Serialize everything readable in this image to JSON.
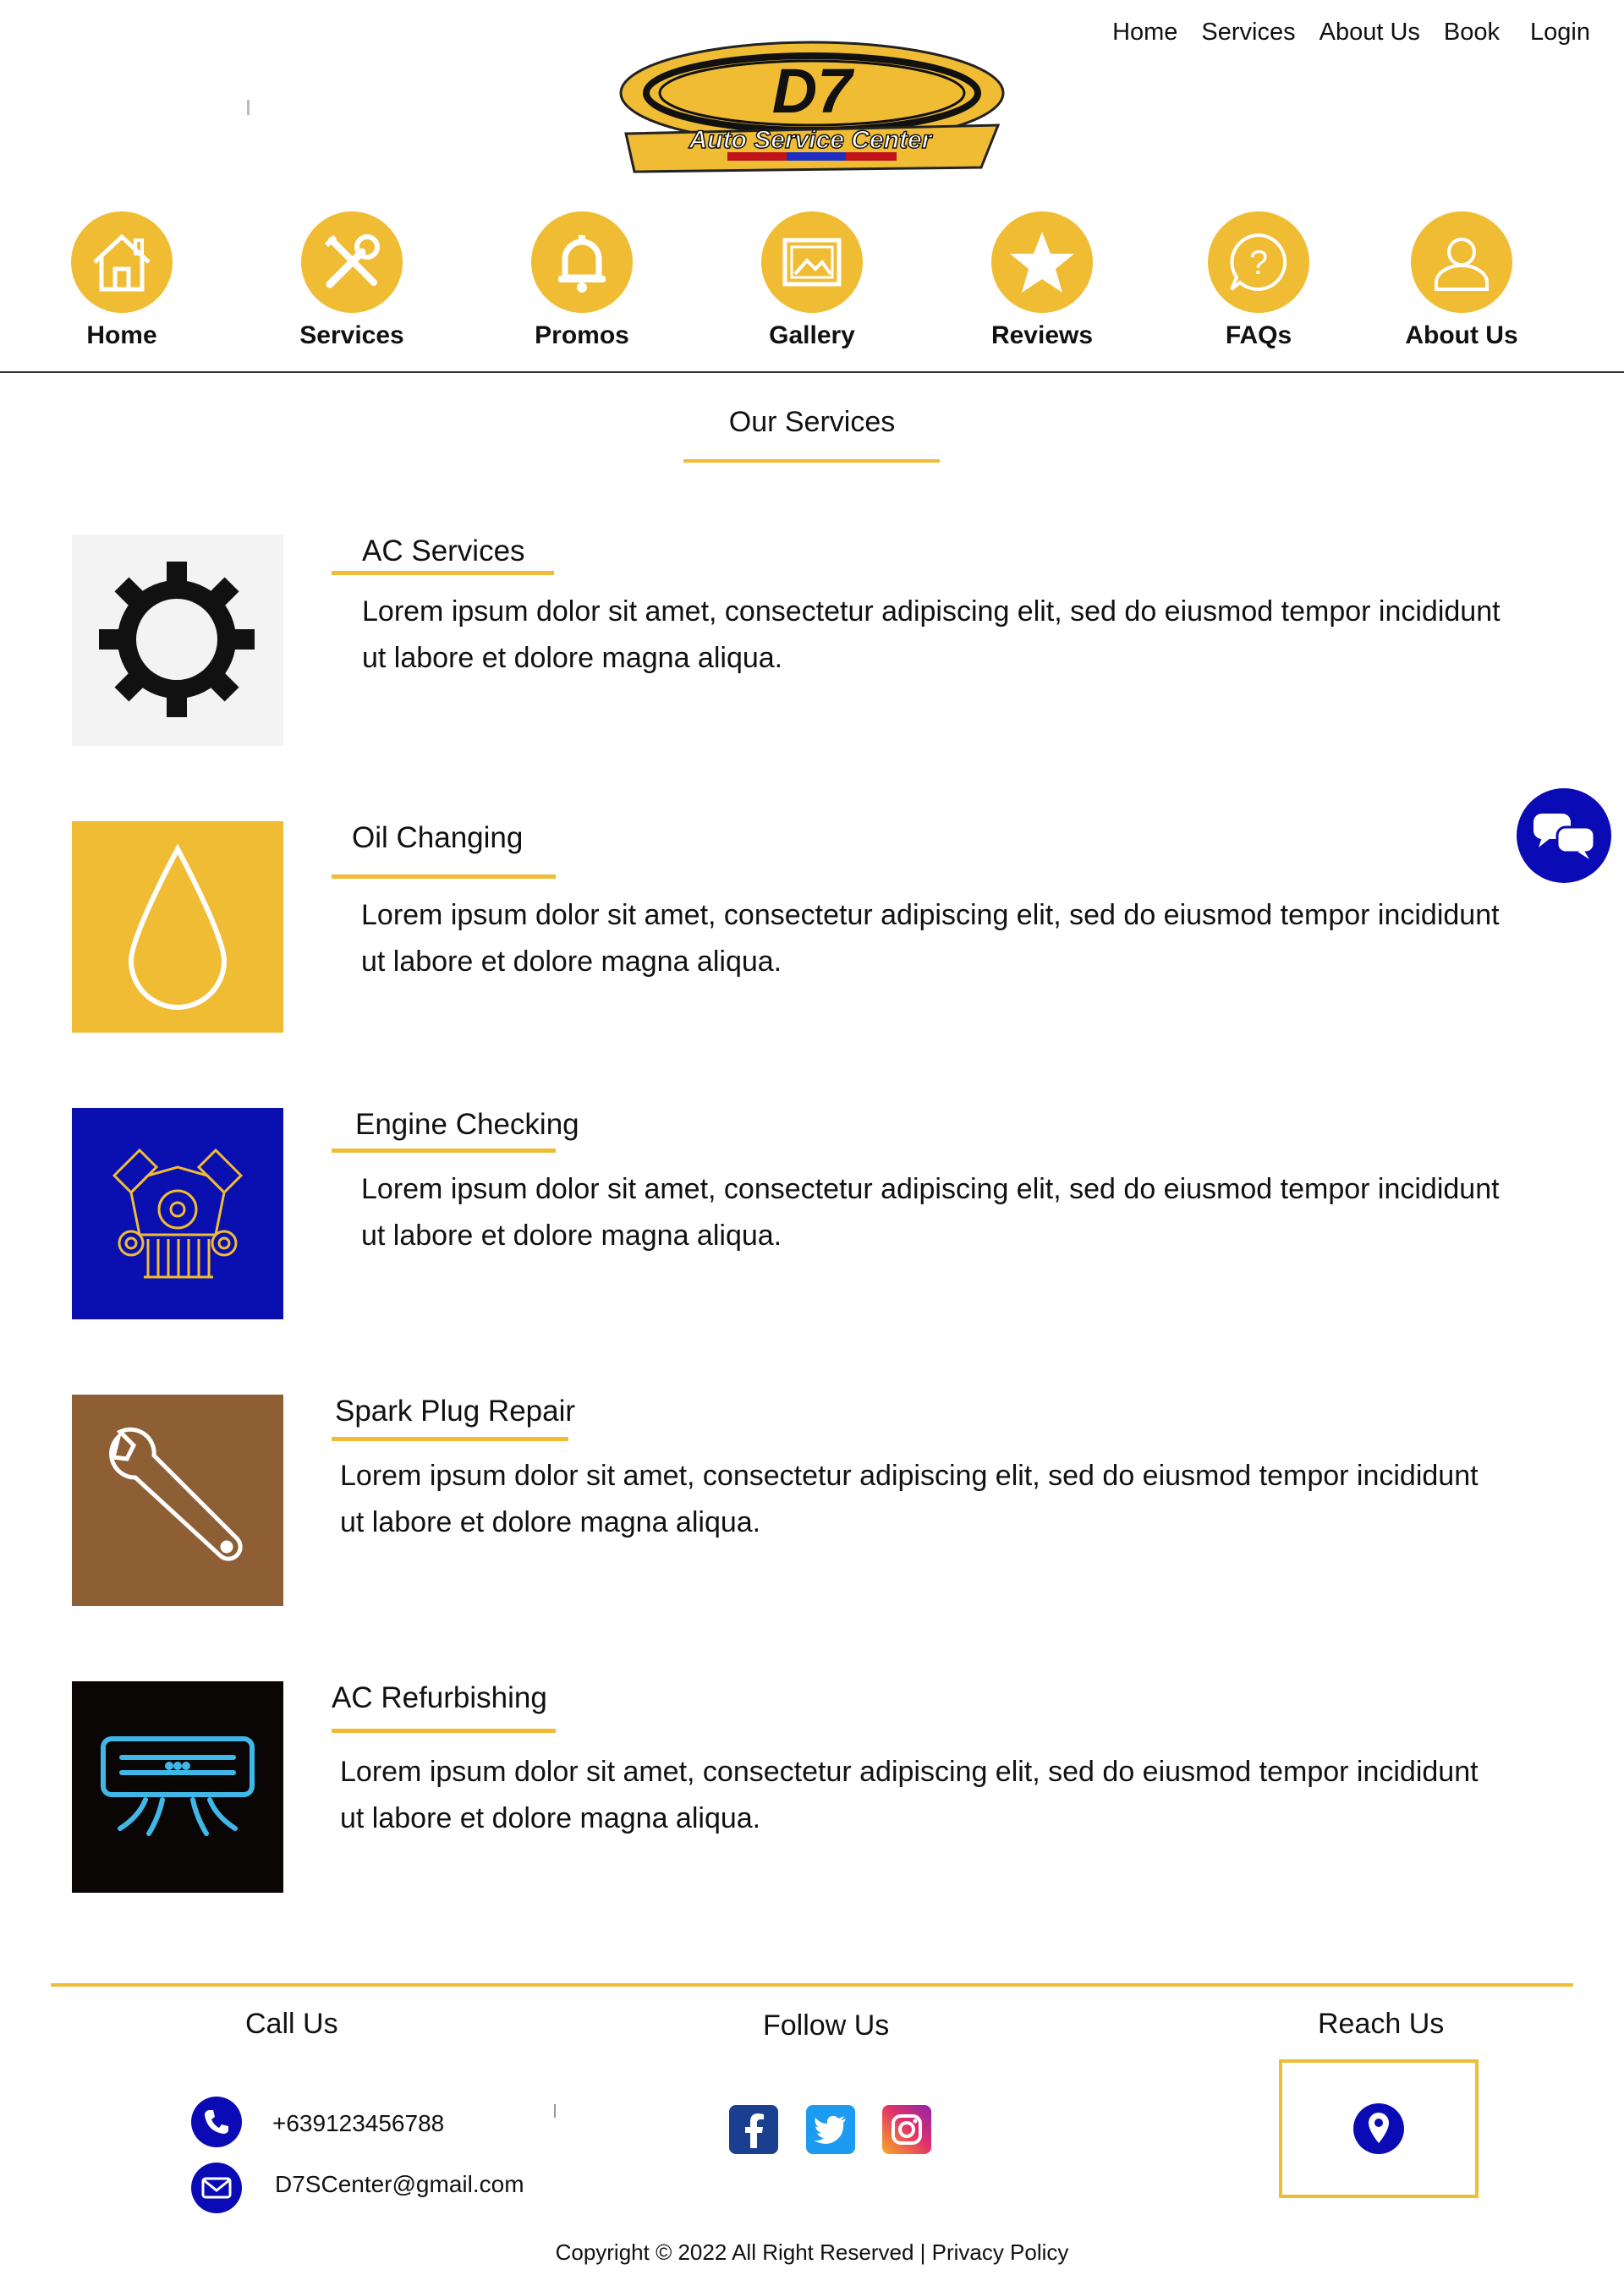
{
  "topnav": [
    "Home",
    "Services",
    "About Us",
    "Book",
    "Login"
  ],
  "logo": {
    "big": "D7",
    "sub": "Auto Service Center"
  },
  "iconnav": [
    {
      "label": "Home",
      "icon": "home-icon"
    },
    {
      "label": "Services",
      "icon": "tools-icon"
    },
    {
      "label": "Promos",
      "icon": "bell-icon"
    },
    {
      "label": "Gallery",
      "icon": "image-icon"
    },
    {
      "label": "Reviews",
      "icon": "star-icon"
    },
    {
      "label": "FAQs",
      "icon": "question-icon"
    },
    {
      "label": "About Us",
      "icon": "user-icon"
    }
  ],
  "section_title": "Our Services",
  "services": [
    {
      "title": "AC Services",
      "desc_line1": "Lorem ipsum dolor sit amet, consectetur adipiscing elit, sed do eiusmod tempor incididunt",
      "desc_line2": "ut labore et dolore magna aliqua.",
      "icon": "gear-icon",
      "bg": "#F3F3F3"
    },
    {
      "title": "Oil Changing",
      "desc_line1": "Lorem ipsum dolor sit amet, consectetur adipiscing elit, sed do eiusmod tempor incididunt",
      "desc_line2": "ut labore et dolore magna aliqua.",
      "icon": "oil-drop-icon",
      "bg": "#F0BC34"
    },
    {
      "title": "Engine Checking",
      "desc_line1": "Lorem ipsum dolor sit amet, consectetur adipiscing elit, sed do eiusmod tempor incididunt",
      "desc_line2": "ut labore et dolore magna aliqua.",
      "icon": "engine-icon",
      "bg": "#0A0FB0"
    },
    {
      "title": "Spark Plug Repair",
      "desc_line1": "Lorem ipsum dolor sit amet, consectetur adipiscing elit, sed do eiusmod tempor incididunt",
      "desc_line2": "ut labore et dolore magna aliqua.",
      "icon": "wrench-icon",
      "bg": "#8E5F34"
    },
    {
      "title": "AC Refurbishing",
      "desc_line1": "Lorem ipsum dolor sit amet, consectetur adipiscing elit, sed do eiusmod tempor incididunt",
      "desc_line2": "ut labore et dolore magna aliqua.",
      "icon": "air-conditioner-icon",
      "bg": "#0B0606"
    }
  ],
  "footer": {
    "call_title": "Call Us",
    "follow_title": "Follow Us",
    "reach_title": "Reach Us",
    "phone": "+639123456788",
    "email": "D7SCenter@gmail.com",
    "copyright": "Copyright © 2022 All Right Reserved | Privacy Policy"
  },
  "colors": {
    "accent": "#F0BC34",
    "brand_blue": "#0B0BB5"
  }
}
